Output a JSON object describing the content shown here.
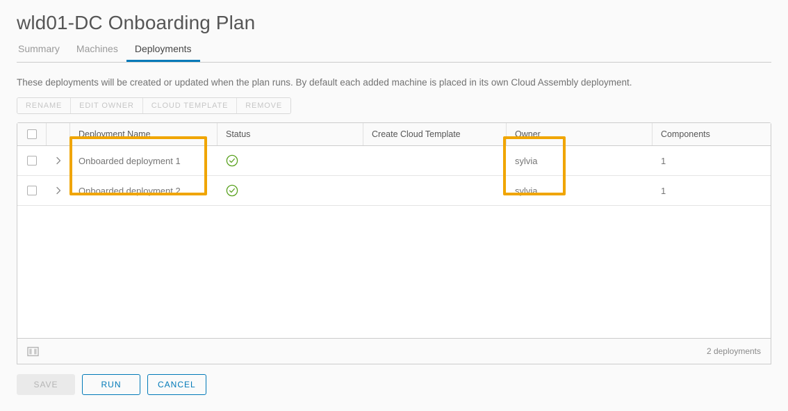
{
  "header": {
    "title": "wld01-DC Onboarding Plan",
    "tabs": [
      {
        "label": "Summary",
        "active": false
      },
      {
        "label": "Machines",
        "active": false
      },
      {
        "label": "Deployments",
        "active": true
      }
    ]
  },
  "main": {
    "description": "These deployments will be created or updated when the plan runs. By default each added machine is placed in its own Cloud Assembly deployment.",
    "toolbar": {
      "rename_label": "RENAME",
      "edit_owner_label": "EDIT OWNER",
      "cloud_template_label": "CLOUD TEMPLATE",
      "remove_label": "REMOVE"
    },
    "grid": {
      "columns": [
        {
          "key": "name",
          "label": "Deployment Name"
        },
        {
          "key": "status",
          "label": "Status"
        },
        {
          "key": "template",
          "label": "Create Cloud Template"
        },
        {
          "key": "owner",
          "label": "Owner"
        },
        {
          "key": "components",
          "label": "Components"
        }
      ],
      "rows": [
        {
          "name": "Onboarded deployment 1",
          "status_icon": "success-check-circle-icon",
          "template": "",
          "owner": "sylvia",
          "components": "1"
        },
        {
          "name": "Onboarded deployment 2",
          "status_icon": "success-check-circle-icon",
          "template": "",
          "owner": "sylvia",
          "components": "1"
        }
      ],
      "footer": {
        "count_label": "2 deployments",
        "toggle_icon": "column-panel-toggle-icon"
      }
    },
    "annotations": [
      {
        "name": "deployment-name-highlight"
      },
      {
        "name": "owner-highlight"
      }
    ]
  },
  "actions": {
    "save_label": "SAVE",
    "run_label": "RUN",
    "cancel_label": "CANCEL"
  },
  "colors": {
    "accent_blue": "#0079b8",
    "highlight_orange": "#f0a500",
    "status_green": "#5aa220",
    "text_grey": "#565656"
  }
}
